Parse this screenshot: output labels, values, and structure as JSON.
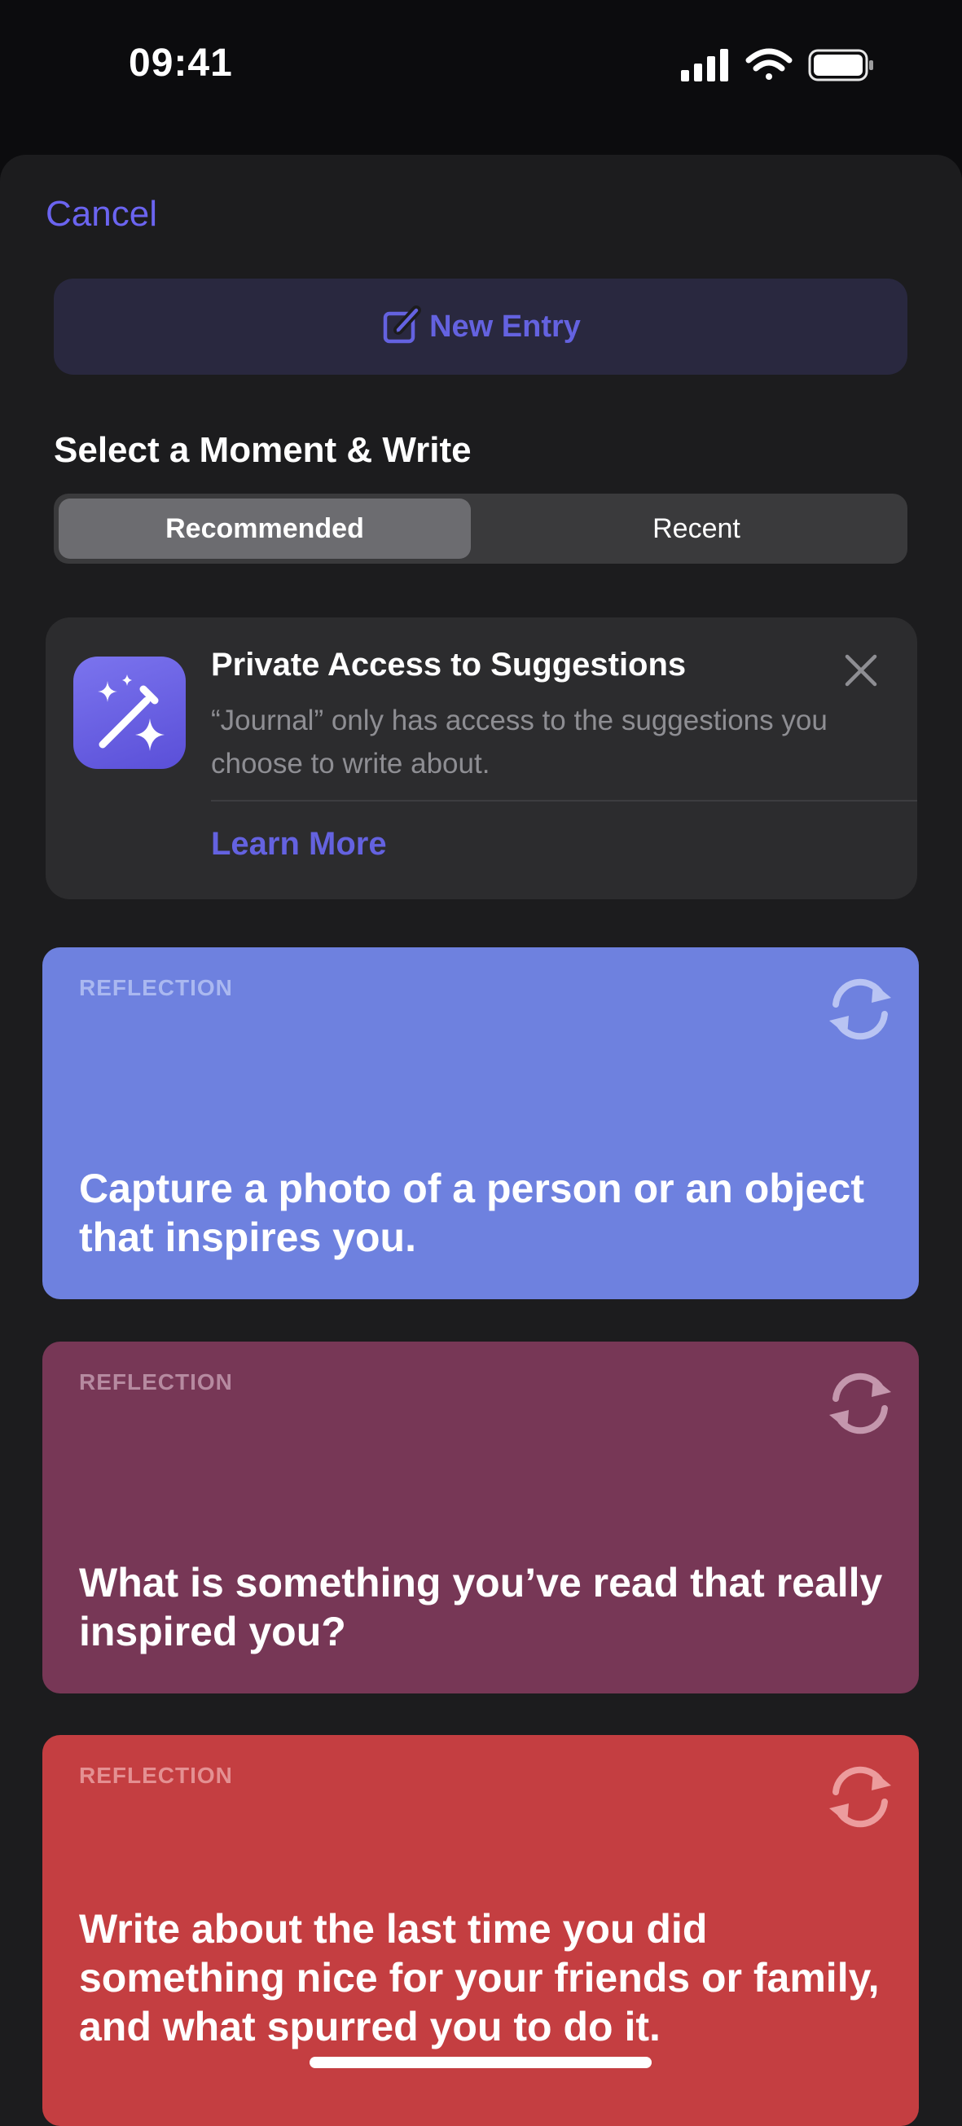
{
  "status_bar": {
    "time": "09:41",
    "icons": [
      "cellular-signal-icon",
      "wifi-icon",
      "battery-icon"
    ]
  },
  "header": {
    "cancel_label": "Cancel",
    "new_entry_label": "New Entry",
    "new_entry_icon": "compose-icon"
  },
  "section": {
    "title": "Select a Moment & Write",
    "tabs": [
      {
        "label": "Recommended",
        "selected": true
      },
      {
        "label": "Recent",
        "selected": false
      }
    ]
  },
  "privacy_card": {
    "icon": "sparkles-wand-icon",
    "title": "Private Access to Suggestions",
    "body": "“Journal” only has access to the suggestions you choose to write about.",
    "link_label": "Learn More",
    "close_icon": "close-icon"
  },
  "prompts": [
    {
      "category": "REFLECTION",
      "text": "Capture a photo of a person or an object that inspires you.",
      "color": "#6e81df"
    },
    {
      "category": "REFLECTION",
      "text": "What is something you’ve read that really inspired you?",
      "color": "#773756"
    },
    {
      "category": "REFLECTION",
      "text": "Write about the last time you did something nice for your friends or family, and what spurred you to do it.",
      "color": "#c43e41"
    }
  ],
  "colors": {
    "accent": "#6462e0",
    "sheet_background": "#1c1c1e",
    "card_background": "#2c2c2e"
  }
}
